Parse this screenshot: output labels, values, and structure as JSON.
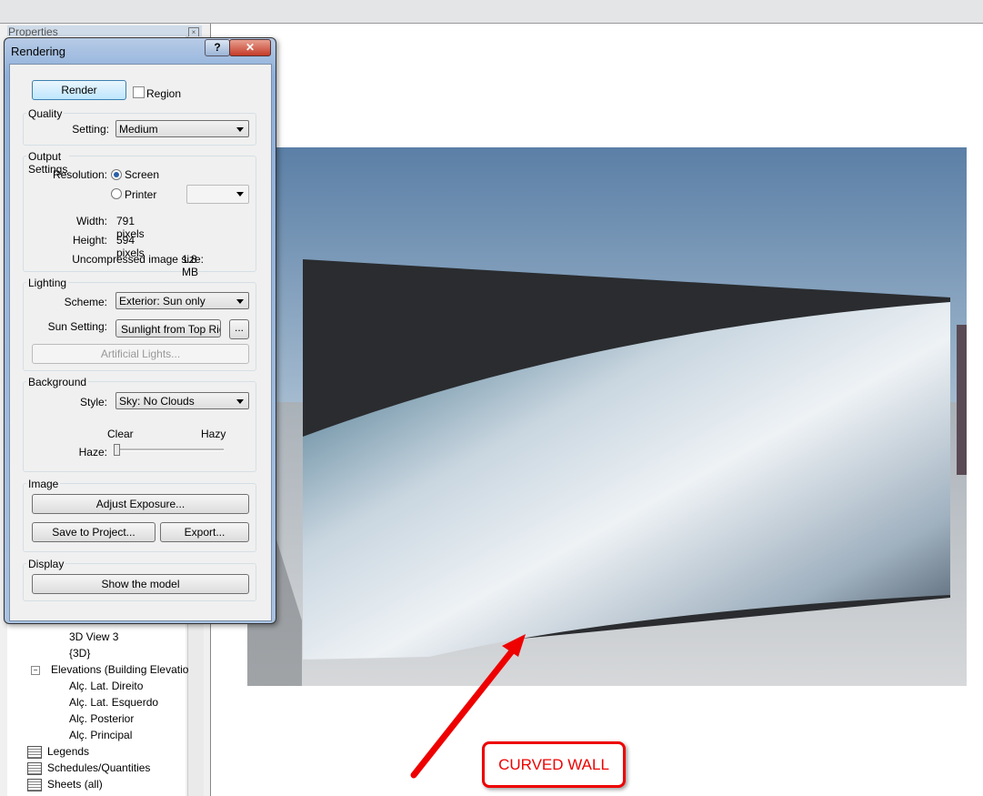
{
  "properties_title": "Properties",
  "browser": {
    "items": [
      {
        "label": "3D View 3",
        "indent": 2
      },
      {
        "label": "{3D}",
        "indent": 2
      },
      {
        "label": "Elevations (Building Elevatio",
        "indent": 1
      },
      {
        "label": "Alç. Lat. Direito",
        "indent": 2
      },
      {
        "label": "Alç. Lat. Esquerdo",
        "indent": 2
      },
      {
        "label": "Alç. Posterior",
        "indent": 2
      },
      {
        "label": "Alç. Principal",
        "indent": 2
      },
      {
        "label": "Legends",
        "indent": 0
      },
      {
        "label": "Schedules/Quantities",
        "indent": 0
      },
      {
        "label": "Sheets (all)",
        "indent": 0
      }
    ]
  },
  "dialog": {
    "title": "Rendering",
    "help": "?",
    "close": "✕",
    "render_button": "Render",
    "region_label": "Region",
    "region_checked": false,
    "quality": {
      "group": "Quality",
      "setting_label": "Setting:",
      "setting_value": "Medium"
    },
    "output": {
      "group": "Output Settings",
      "resolution_label": "Resolution:",
      "screen": "Screen",
      "printer": "Printer",
      "selected": "Screen",
      "width_label": "Width:",
      "width_value": "791 pixels",
      "height_label": "Height:",
      "height_value": "594 pixels",
      "size_label": "Uncompressed image size:",
      "size_value": "1.8 MB"
    },
    "lighting": {
      "group": "Lighting",
      "scheme_label": "Scheme:",
      "scheme_value": "Exterior: Sun only",
      "sun_label": "Sun Setting:",
      "sun_value": "Sunlight from Top Righ",
      "more": "...",
      "artificial": "Artificial Lights..."
    },
    "background": {
      "group": "Background",
      "style_label": "Style:",
      "style_value": "Sky: No Clouds",
      "clear": "Clear",
      "hazy": "Hazy",
      "haze_label": "Haze:",
      "haze_value": 0
    },
    "image": {
      "group": "Image",
      "adjust": "Adjust Exposure...",
      "save": "Save to Project...",
      "export": "Export..."
    },
    "display": {
      "group": "Display",
      "show": "Show the model"
    }
  },
  "annotation": {
    "label": "CURVED WALL",
    "color": "#e00000"
  }
}
